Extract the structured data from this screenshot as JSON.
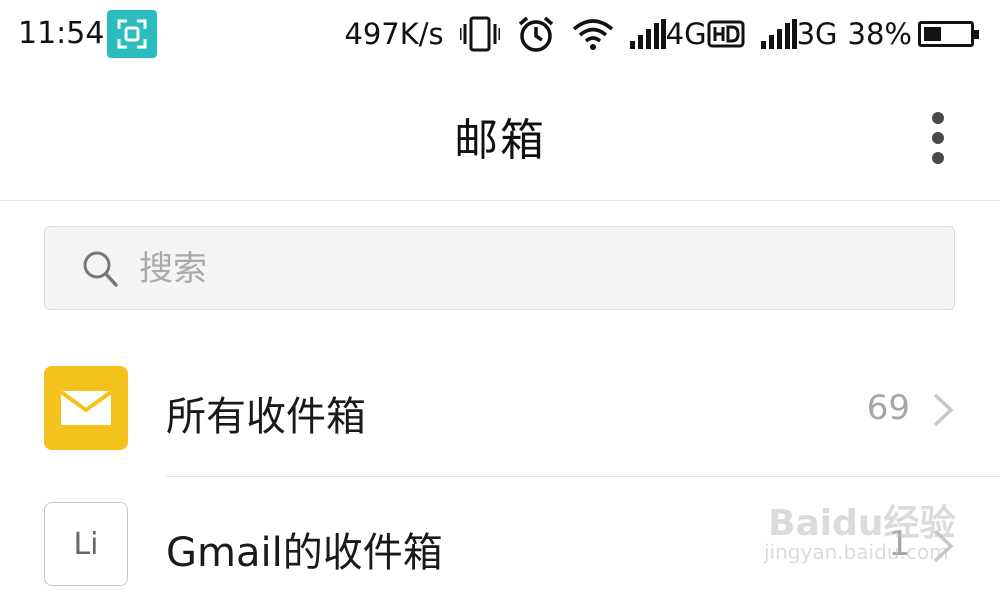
{
  "status_bar": {
    "time": "11:54",
    "net_speed": "497K/s",
    "network_1": "4G",
    "network_1_badge": "HD",
    "network_2": "3G",
    "battery_percent": "38%",
    "battery_level": 0.38,
    "icons": [
      "screenshot-icon",
      "vibrate-icon",
      "alarm-icon",
      "wifi-icon",
      "signal-icon",
      "signal-icon",
      "battery-icon"
    ]
  },
  "header": {
    "title": "邮箱",
    "menu_icon": "more-vertical-icon"
  },
  "search": {
    "placeholder": "搜索",
    "value": "",
    "icon": "search-icon"
  },
  "mailboxes": [
    {
      "label": "所有收件箱",
      "count": "69",
      "icon": "envelope-icon",
      "icon_color": "#f4c21c"
    },
    {
      "label": "Gmail的收件箱",
      "count": "1",
      "avatar_text": "Li"
    }
  ],
  "watermark": {
    "text": "Baidu经验",
    "url": "jingyan.baidu.com"
  },
  "colors": {
    "accent_teal": "#2bbcc0",
    "mail_yellow": "#f4c21c",
    "count_gray": "#a6a6a6"
  }
}
